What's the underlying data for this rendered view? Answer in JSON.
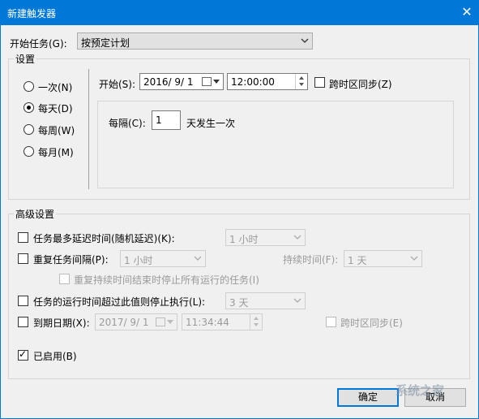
{
  "window": {
    "title": "新建触发器",
    "close": "✕"
  },
  "begin_task": {
    "label": "开始任务(G):",
    "value": "按预定计划"
  },
  "settings": {
    "legend": "设置",
    "radios": [
      {
        "label": "一次(N)",
        "checked": false
      },
      {
        "label": "每天(D)",
        "checked": true
      },
      {
        "label": "每周(W)",
        "checked": false
      },
      {
        "label": "每月(M)",
        "checked": false
      }
    ],
    "start_label": "开始(S):",
    "start_date": "2016/ 9/ 1",
    "start_time": "12:00:00",
    "sync_timezone_label": "跨时区同步(Z)",
    "recur_label": "每隔(C):",
    "recur_value": "1",
    "recur_unit": "天发生一次"
  },
  "advanced": {
    "legend": "高级设置",
    "delay_label": "任务最多延迟时间(随机延迟)(K):",
    "delay_value": "1 小时",
    "repeat_label": "重复任务间隔(P):",
    "repeat_value": "1 小时",
    "duration_label": "持续时间(F):",
    "duration_value": "1 天",
    "stop_all_label": "重复持续时间结束时停止所有运行的任务(I)",
    "stop_if_label": "任务的运行时间超过此值则停止执行(L):",
    "stop_if_value": "3 天",
    "expire_label": "到期日期(X):",
    "expire_date": "2017/ 9/ 1",
    "expire_time": "11:34:44",
    "expire_sync_label": "跨时区同步(E)",
    "enabled_label": "已启用(B)"
  },
  "buttons": {
    "ok": "确定",
    "cancel": "取消"
  },
  "watermark": "系统之家"
}
